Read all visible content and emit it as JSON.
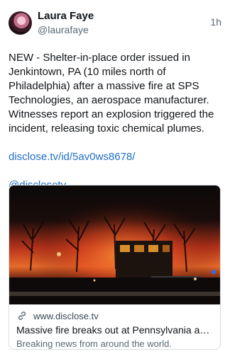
{
  "author": {
    "display_name": "Laura Faye",
    "handle": "@laurafaye"
  },
  "timestamp": "1h",
  "post": {
    "body": "NEW - Shelter-in-place order issued in Jenkintown, PA (10 miles north of Philadelphia) after a massive fire at SPS Technologies, an aerospace manufacturer. Witnesses report an explosion triggered the incident, releasing toxic chemical plumes.",
    "link_text": "disclose.tv/id/5av0ws8678/",
    "mention": "@disclosetv"
  },
  "card": {
    "domain": "www.disclose.tv",
    "title": "Massive fire breaks out at Pennsylvania aerospace manufacturer",
    "description": "Breaking news from around the world.",
    "image_icon": "fire-night-photo"
  },
  "colors": {
    "link": "#1f6ec7",
    "secondary_text": "#5b6873",
    "border": "#d7dde2"
  }
}
